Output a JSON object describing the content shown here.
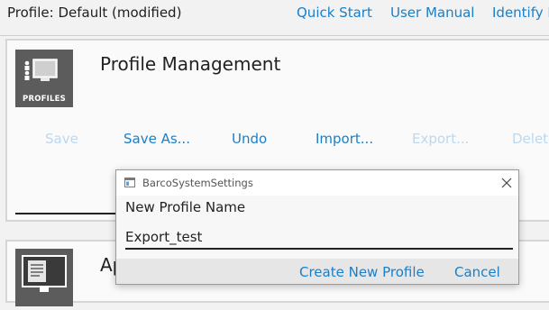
{
  "topbar": {
    "profile_status": "Profile: Default (modified)",
    "links": [
      "Quick Start",
      "User Manual",
      "Identify M"
    ]
  },
  "profile_card": {
    "icon": "profiles-icon",
    "icon_label": "PROFILES",
    "title": "Profile Management",
    "actions": [
      {
        "label": "Save",
        "enabled": false
      },
      {
        "label": "Save As...",
        "enabled": true
      },
      {
        "label": "Undo",
        "enabled": true
      },
      {
        "label": "Import...",
        "enabled": true
      },
      {
        "label": "Export...",
        "enabled": false
      },
      {
        "label": "Delete",
        "enabled": false
      }
    ]
  },
  "second_card": {
    "icon": "display-icon",
    "title_partial": "Ap"
  },
  "dialog": {
    "title": "BarcoSystemSettings",
    "field_label": "New Profile Name",
    "input_value": "Export_test",
    "create_label": "Create New Profile",
    "cancel_label": "Cancel"
  },
  "colors": {
    "accent": "#1a7fc8",
    "disabled": "#bcd8ee",
    "tile": "#5c5c5c",
    "background": "#f2f2f2"
  }
}
